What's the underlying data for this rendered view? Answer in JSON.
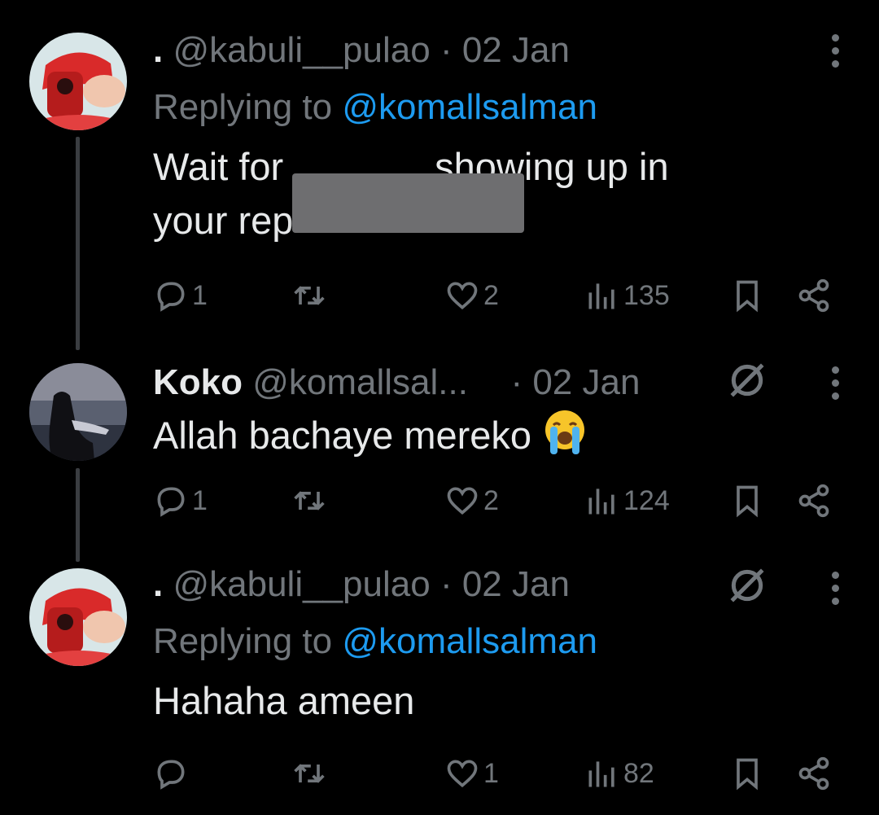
{
  "tweets": [
    {
      "display_name": ".",
      "handle": "@kabuli__pulao",
      "separator": "·",
      "date": "02 Jan",
      "replying_prefix": "Replying to",
      "replying_to": "@komallsalman",
      "text_line1_a": "Wait for",
      "text_line1_b": "showing up in",
      "text_line2_a": "your rep",
      "stats": {
        "replies": "1",
        "retweets": "",
        "likes": "2",
        "views": "135"
      }
    },
    {
      "display_name": "Koko",
      "handle": "@komallsal...",
      "separator": "·",
      "date": "02 Jan",
      "text": "Allah bachaye mereko",
      "stats": {
        "replies": "1",
        "retweets": "",
        "likes": "2",
        "views": "124"
      }
    },
    {
      "display_name": ".",
      "handle": "@kabuli__pulao",
      "separator": "·",
      "date": "02 Jan",
      "replying_prefix": "Replying to",
      "replying_to": "@komallsalman",
      "text": "Hahaha ameen",
      "stats": {
        "replies": "",
        "retweets": "",
        "likes": "1",
        "views": "82"
      }
    }
  ],
  "colors": {
    "background": "#000000",
    "text": "#e7e9ea",
    "muted": "#71767b",
    "link": "#1d9bf0"
  },
  "icons": [
    "more-icon",
    "mute-icon",
    "reply-icon",
    "retweet-icon",
    "like-icon",
    "views-icon",
    "bookmark-icon",
    "share-icon",
    "crying-emoji",
    "redaction-box"
  ]
}
